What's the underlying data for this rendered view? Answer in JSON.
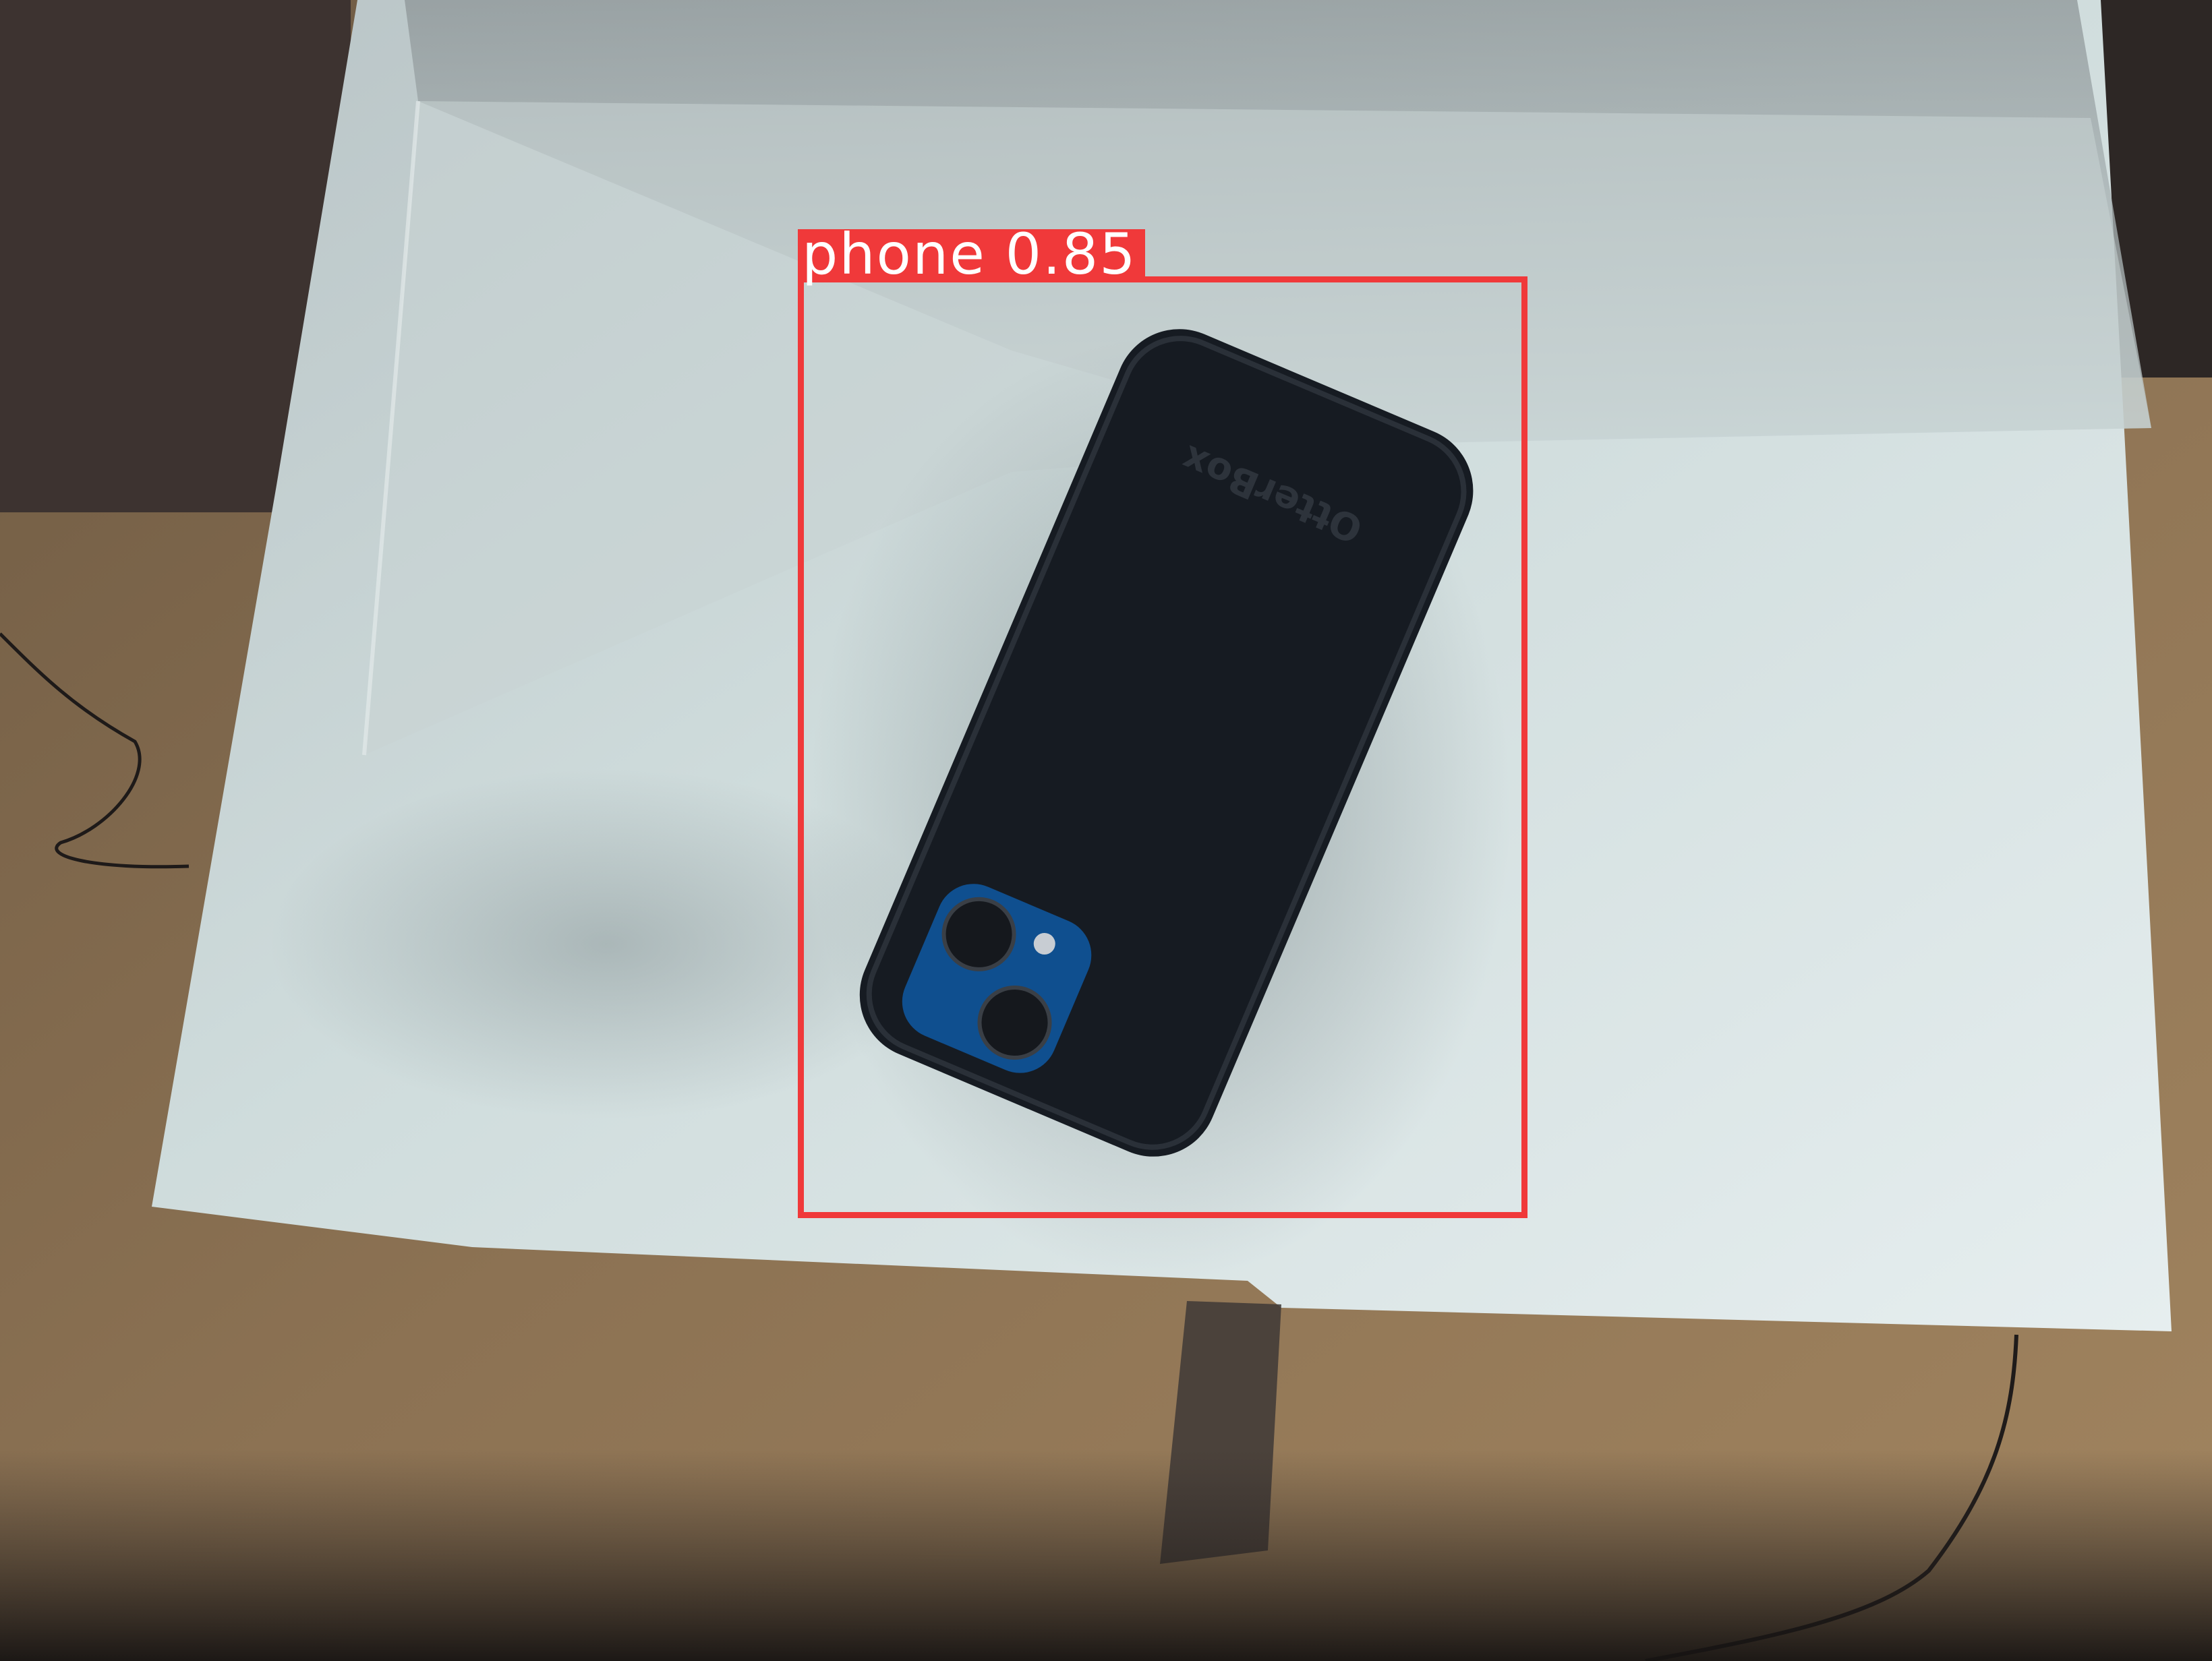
{
  "detection": {
    "class_label": "phone",
    "confidence": "0.85",
    "box_color": "#f0393a"
  },
  "scene": {
    "phone_case_text": "OtterBox"
  }
}
